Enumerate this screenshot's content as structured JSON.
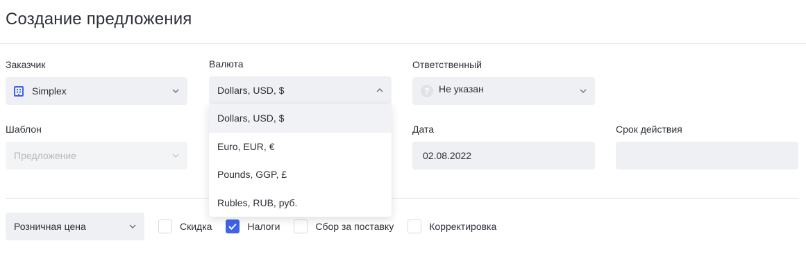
{
  "page": {
    "title": "Создание предложения"
  },
  "customer": {
    "label": "Заказчик",
    "value": "Simplex"
  },
  "currency": {
    "label": "Валюта",
    "value": "Dollars, USD, $",
    "options": [
      "Dollars, USD, $",
      "Euro, EUR, €",
      "Pounds, GGP, £",
      "Rubles, RUB, руб."
    ]
  },
  "responsible": {
    "label": "Ответственный",
    "value": "Не указан"
  },
  "template": {
    "label": "Шаблон",
    "placeholder": "Предложение"
  },
  "date": {
    "label": "Дата",
    "value": "02.08.2022"
  },
  "validity": {
    "label": "Срок действия",
    "value": ""
  },
  "price": {
    "value": "Розничная цена"
  },
  "options": {
    "discount": {
      "label": "Скидка",
      "checked": false
    },
    "taxes": {
      "label": "Налоги",
      "checked": true
    },
    "delivery": {
      "label": "Сбор за поставку",
      "checked": false
    },
    "adjustment": {
      "label": "Корректировка",
      "checked": false
    }
  },
  "colors": {
    "accent": "#3f63e6",
    "field_bg": "#eef0f4"
  }
}
